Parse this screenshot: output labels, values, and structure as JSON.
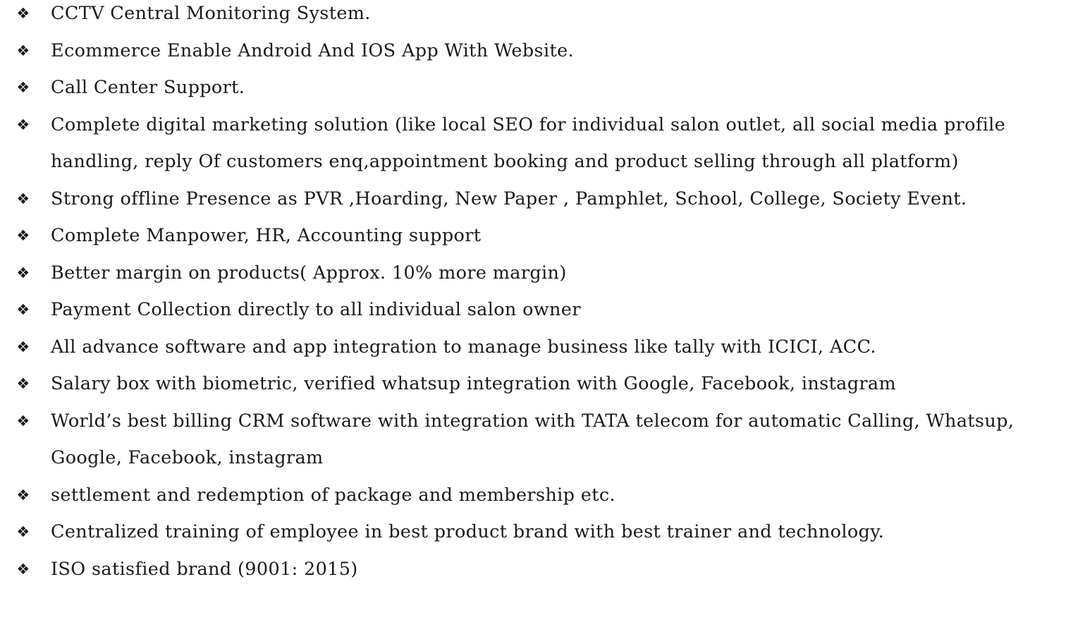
{
  "bullet_glyph": "❖",
  "items": [
    "CCTV Central Monitoring System.",
    "Ecommerce Enable Android And IOS App With Website.",
    "Call Center Support.",
    "Complete digital marketing solution (like local SEO for individual salon outlet,  all social media profile handling, reply Of customers enq,appointment booking and product selling through all platform)",
    "Strong offline Presence as PVR ,Hoarding, New Paper , Pamphlet, School, College, Society Event.",
    "Complete Manpower, HR, Accounting support",
    "Better margin on products( Approx. 10% more margin)",
    "Payment Collection directly to all individual salon owner",
    "All advance software and app integration to manage business like tally with ICICI, ACC.",
    "Salary box with biometric, verified whatsup integration with Google, Facebook, instagram",
    "World’s best billing CRM software with integration with TATA telecom for automatic Calling, Whatsup, Google, Facebook, instagram",
    " settlement and redemption of package and membership etc.",
    "Centralized training of employee in best product brand with best trainer and technology.",
    "ISO satisfied brand (9001: 2015)"
  ]
}
